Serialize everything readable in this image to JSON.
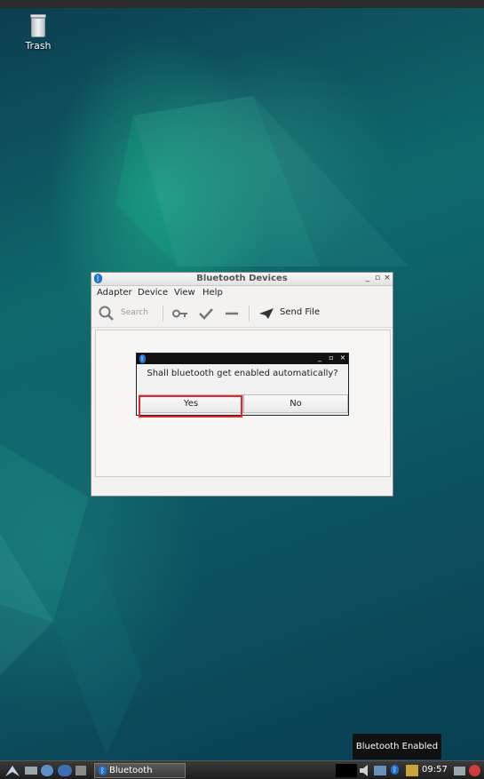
{
  "desktop": {
    "icons": [
      {
        "label": "Trash",
        "icon": "trash-icon"
      }
    ]
  },
  "window": {
    "title": "Bluetooth Devices",
    "controls": {
      "minimize": "_",
      "maximize": "▫",
      "close": "×"
    },
    "menu": [
      "Adapter",
      "Device",
      "View",
      "Help"
    ],
    "toolbar": {
      "search_label": "Search",
      "send_file_label": "Send File"
    }
  },
  "dialog": {
    "question": "Shall bluetooth get enabled automatically?",
    "yes_label": "Yes",
    "no_label": "No",
    "controls": {
      "minimize": "_",
      "maximize": "▫",
      "close": "×"
    }
  },
  "taskbar": {
    "task_label": "Bluetooth Devices",
    "clock": "09:57"
  },
  "notification": {
    "text": "Bluetooth Enabled"
  },
  "colors": {
    "highlight": "#e2262b",
    "bluetooth": "#1f6fd1"
  }
}
